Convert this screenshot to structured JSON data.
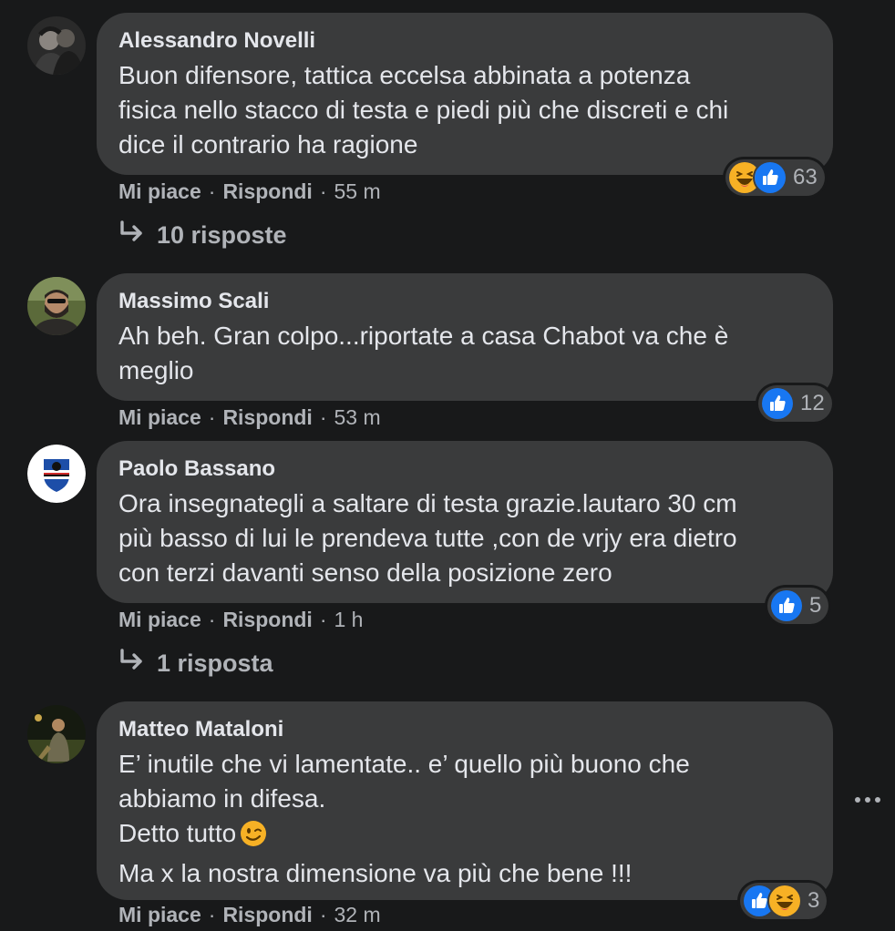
{
  "comments": [
    {
      "author": "Alessandro Novelli",
      "lines": [
        "Buon difensore, tattica eccelsa abbinata a potenza",
        "fisica nello stacco di testa e piedi più che discreti e chi",
        "dice il contrario ha ragione"
      ],
      "like_label": "Mi piace",
      "reply_label": "Rispondi",
      "time": "55 m",
      "reaction_count": "63",
      "reaction_icons": [
        "haha-icon",
        "like-icon"
      ],
      "replies_label": "10 risposte"
    },
    {
      "author": "Massimo Scali",
      "lines": [
        "Ah beh. Gran colpo...riportate a casa Chabot va che è",
        "meglio"
      ],
      "like_label": "Mi piace",
      "reply_label": "Rispondi",
      "time": "53 m",
      "reaction_count": "12",
      "reaction_icons": [
        "like-icon"
      ]
    },
    {
      "author": "Paolo Bassano",
      "lines": [
        "Ora insegnategli a saltare di testa grazie.lautaro 30 cm",
        "più basso di lui le prendeva tutte ,con de vrjy era dietro",
        "con terzi davanti senso della posizione zero"
      ],
      "like_label": "Mi piace",
      "reply_label": "Rispondi",
      "time": "1 h",
      "reaction_count": "5",
      "reaction_icons": [
        "like-icon"
      ],
      "replies_label": "1 risposta"
    },
    {
      "author": "Matteo Mataloni",
      "lines": [
        "E’ inutile che vi lamentate.. e’ quello più buono che",
        "abbiamo in difesa.",
        "Detto tutto",
        "Ma x la nostra dimensione va più che bene !!!"
      ],
      "like_label": "Mi piace",
      "reply_label": "Rispondi",
      "time": "32 m",
      "reaction_count": "3",
      "reaction_icons": [
        "like-icon",
        "haha-icon"
      ]
    }
  ],
  "separator": "·",
  "colors": {
    "background": "#18191a",
    "bubble": "#3a3b3c",
    "text": "#e4e6eb",
    "secondary": "#b0b3b8",
    "like_blue": "#1877f2",
    "haha_yellow": "#f7b125"
  }
}
